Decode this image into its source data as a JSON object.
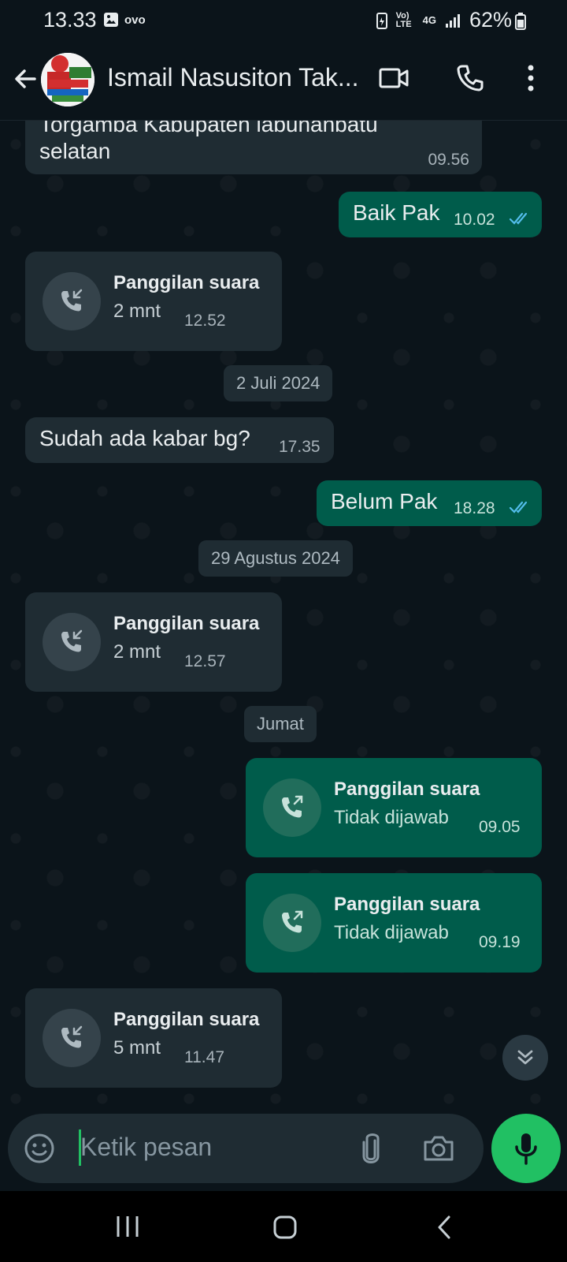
{
  "status_bar": {
    "time": "13.33",
    "ovo_label": "ovo",
    "network": "4G",
    "volte": "Vo) LTE",
    "battery": "62%"
  },
  "header": {
    "contact_name": "Ismail Nasusiton Tak...",
    "icons": [
      "back-arrow-icon",
      "video-call-icon",
      "voice-call-icon",
      "more-options-icon"
    ]
  },
  "messages": {
    "m1": {
      "text": "Torgamba Kabupaten labunanbatu\nselatan",
      "time": "09.56"
    },
    "m2": {
      "text": "Baik Pak",
      "time": "10.02"
    },
    "c1": {
      "title": "Panggilan suara",
      "sub": "2 mnt",
      "time": "12.52"
    },
    "d1": "2 Juli 2024",
    "m3": {
      "text": "Sudah ada kabar bg?",
      "time": "17.35"
    },
    "m4": {
      "text": "Belum Pak",
      "time": "18.28"
    },
    "d2": "29 Agustus 2024",
    "c2": {
      "title": "Panggilan suara",
      "sub": "2 mnt",
      "time": "12.57"
    },
    "d3": "Jumat",
    "c3": {
      "title": "Panggilan suara",
      "sub": "Tidak dijawab",
      "time": "09.05"
    },
    "c4": {
      "title": "Panggilan suara",
      "sub": "Tidak dijawab",
      "time": "09.19"
    },
    "c5": {
      "title": "Panggilan suara",
      "sub": "5 mnt",
      "time": "11.47"
    }
  },
  "composer": {
    "placeholder": "Ketik pesan"
  },
  "colors": {
    "background": "#0b141a",
    "incoming_bubble": "#1f2c33",
    "outgoing_bubble": "#005c4b",
    "accent": "#21c063",
    "read_tick": "#53bdeb"
  }
}
